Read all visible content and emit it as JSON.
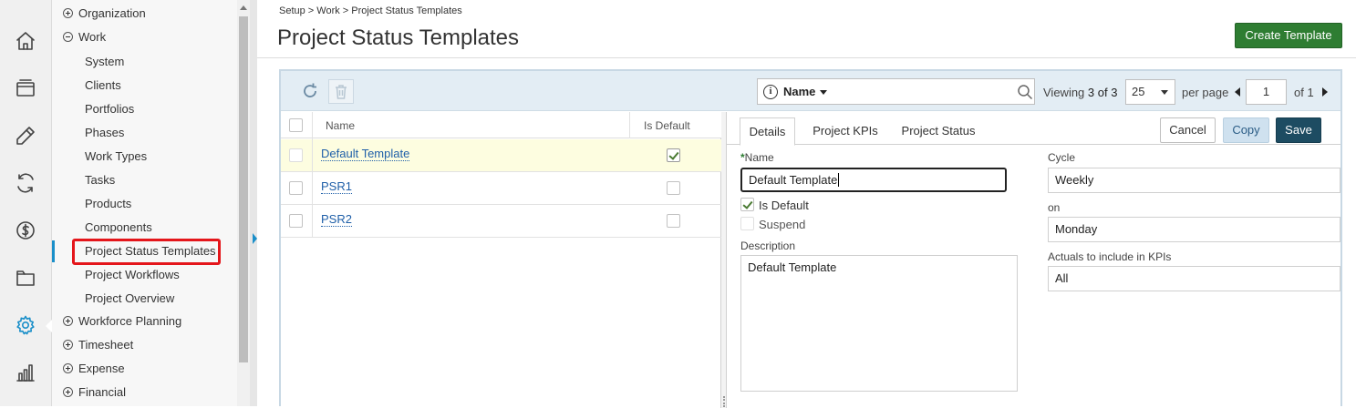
{
  "iconbar": {
    "icons": [
      "home-icon",
      "projects-icon",
      "pencil-icon",
      "sync-icon",
      "billing-icon",
      "folder-icon",
      "settings-icon",
      "reports-icon"
    ],
    "active": "settings-icon",
    "accent_color": "#1a8fc9"
  },
  "nav": {
    "items": [
      {
        "label": "Organization",
        "type": "top",
        "state": "collapsed"
      },
      {
        "label": "Work",
        "type": "top",
        "state": "expanded"
      },
      {
        "label": "System",
        "type": "child"
      },
      {
        "label": "Clients",
        "type": "child"
      },
      {
        "label": "Portfolios",
        "type": "child"
      },
      {
        "label": "Phases",
        "type": "child"
      },
      {
        "label": "Work Types",
        "type": "child"
      },
      {
        "label": "Tasks",
        "type": "child"
      },
      {
        "label": "Products",
        "type": "child"
      },
      {
        "label": "Components",
        "type": "child"
      },
      {
        "label": "Project Status Templates",
        "type": "child",
        "selected": true
      },
      {
        "label": "Project Workflows",
        "type": "child"
      },
      {
        "label": "Project Overview",
        "type": "child"
      },
      {
        "label": "Workforce Planning",
        "type": "top",
        "state": "collapsed"
      },
      {
        "label": "Timesheet",
        "type": "top",
        "state": "collapsed"
      },
      {
        "label": "Expense",
        "type": "top",
        "state": "collapsed"
      },
      {
        "label": "Financial",
        "type": "top",
        "state": "collapsed"
      }
    ],
    "highlight_color": "#e4161b"
  },
  "header": {
    "breadcrumb": "Setup > Work > Project Status Templates",
    "title": "Project Status Templates",
    "create_button": "Create Template",
    "create_color": "#2e7d32"
  },
  "toolbar": {
    "search_field_label": "Name",
    "viewing_label": "Viewing",
    "viewing_range": "3 of 3",
    "page_size": "25",
    "per_page_label": "per page",
    "page": "1",
    "of_pages": "of 1"
  },
  "grid": {
    "columns": [
      "Name",
      "Is Default"
    ],
    "rows": [
      {
        "name": "Default Template",
        "is_default": true,
        "selected": true
      },
      {
        "name": "PSR1",
        "is_default": false,
        "selected": false
      },
      {
        "name": "PSR2",
        "is_default": false,
        "selected": false
      }
    ]
  },
  "detail": {
    "tabs": [
      "Details",
      "Project KPIs",
      "Project Status"
    ],
    "active_tab": "Details",
    "buttons": {
      "cancel": "Cancel",
      "copy": "Copy",
      "save": "Save"
    },
    "save_color": "#1d4c62",
    "name_label": "Name",
    "name_required_mark": "*",
    "name_value": "Default Template",
    "is_default_label": "Is Default",
    "is_default": true,
    "suspend_label": "Suspend",
    "suspend": false,
    "description_label": "Description",
    "description_value": "Default Template",
    "cycle_label": "Cycle",
    "cycle_value": "Weekly",
    "on_label": "on",
    "on_value": "Monday",
    "actuals_label": "Actuals to include in KPIs",
    "actuals_value": "All"
  }
}
